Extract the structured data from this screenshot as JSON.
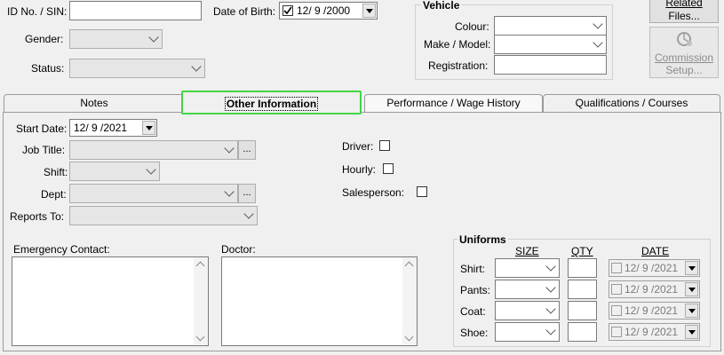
{
  "top": {
    "id_label": "ID No. / SIN:",
    "id_value": "",
    "dob_label": "Date of Birth:",
    "dob_value": "12/ 9 /2000",
    "gender_label": "Gender:",
    "status_label": "Status:"
  },
  "vehicle": {
    "title": "Vehicle",
    "colour_label": "Colour:",
    "make_label": "Make / Model:",
    "registration_label": "Registration:"
  },
  "buttons": {
    "related_files_line1": "Related",
    "related_files_line2": "Files...",
    "commission_line1": "Commission",
    "commission_line2": "Setup..."
  },
  "tabs": [
    {
      "label": "Notes"
    },
    {
      "label": "Other Information"
    },
    {
      "label": "Performance / Wage History"
    },
    {
      "label": "Qualifications / Courses"
    }
  ],
  "other": {
    "start_date_label": "Start Date:",
    "start_date_value": "12/ 9 /2021",
    "job_title_label": "Job Title:",
    "shift_label": "Shift:",
    "dept_label": "Dept:",
    "reports_to_label": "Reports To:",
    "driver_label": "Driver:",
    "hourly_label": "Hourly:",
    "salesperson_label": "Salesperson:",
    "ellipsis": "...",
    "emergency_label": "Emergency Contact:",
    "doctor_label": "Doctor:"
  },
  "uniforms": {
    "title": "Uniforms",
    "size_header": "SIZE",
    "qty_header": "QTY",
    "date_header": "DATE",
    "rows": [
      {
        "label": "Shirt:",
        "date": "12/ 9 /2021"
      },
      {
        "label": "Pants:",
        "date": "12/ 9 /2021"
      },
      {
        "label": "Coat:",
        "date": "12/ 9 /2021"
      },
      {
        "label": "Shoe:",
        "date": "12/ 9 /2021"
      }
    ]
  },
  "colors": {
    "highlight": "#44d444"
  }
}
